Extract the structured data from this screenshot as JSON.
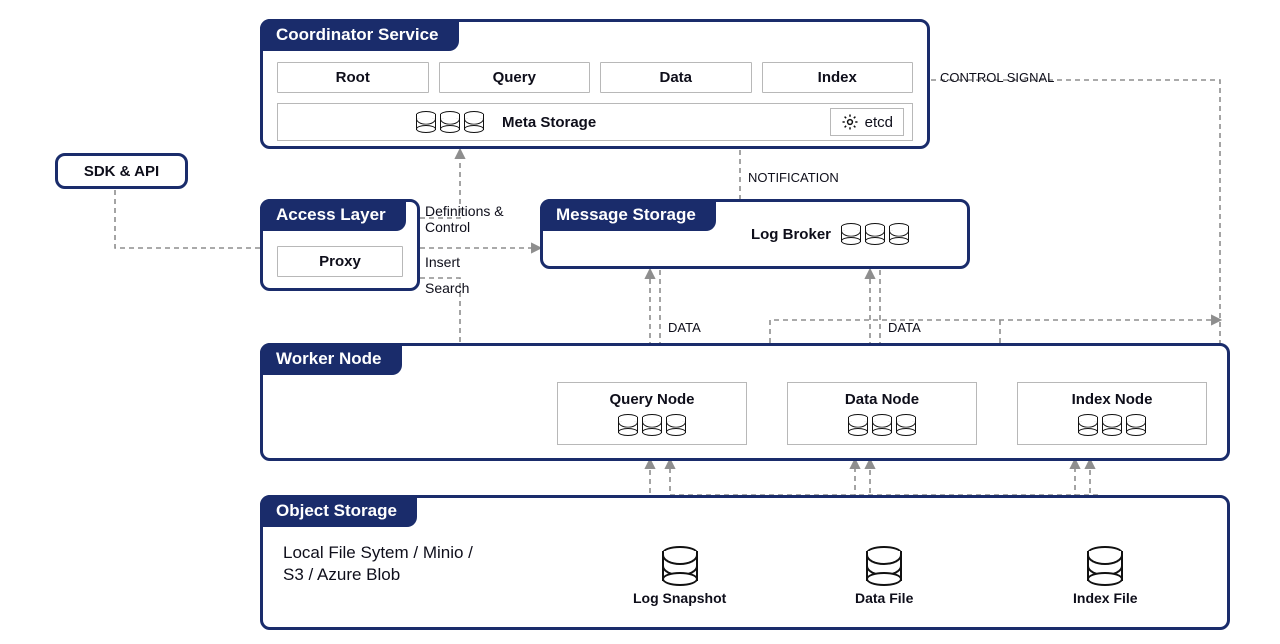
{
  "sdk": {
    "label": "SDK & API"
  },
  "coordinator": {
    "title": "Coordinator Service",
    "items": [
      "Root",
      "Query",
      "Data",
      "Index"
    ],
    "meta_label": "Meta Storage",
    "etcd_label": "etcd"
  },
  "access": {
    "title": "Access Layer",
    "proxy_label": "Proxy"
  },
  "message": {
    "title": "Message Storage",
    "log_broker_label": "Log Broker"
  },
  "worker": {
    "title": "Worker Node",
    "nodes": [
      "Query Node",
      "Data Node",
      "Index Node"
    ]
  },
  "object": {
    "title": "Object Storage",
    "desc": "Local File Sytem / Minio /\nS3 / Azure Blob",
    "items": [
      "Log Snapshot",
      "Data File",
      "Index File"
    ]
  },
  "annotations": {
    "control_signal": "CONTROL SIGNAL",
    "notification": "NOTIFICATION",
    "definitions": "Definitions &\nControl",
    "insert": "Insert",
    "search": "Search",
    "data": "DATA"
  }
}
